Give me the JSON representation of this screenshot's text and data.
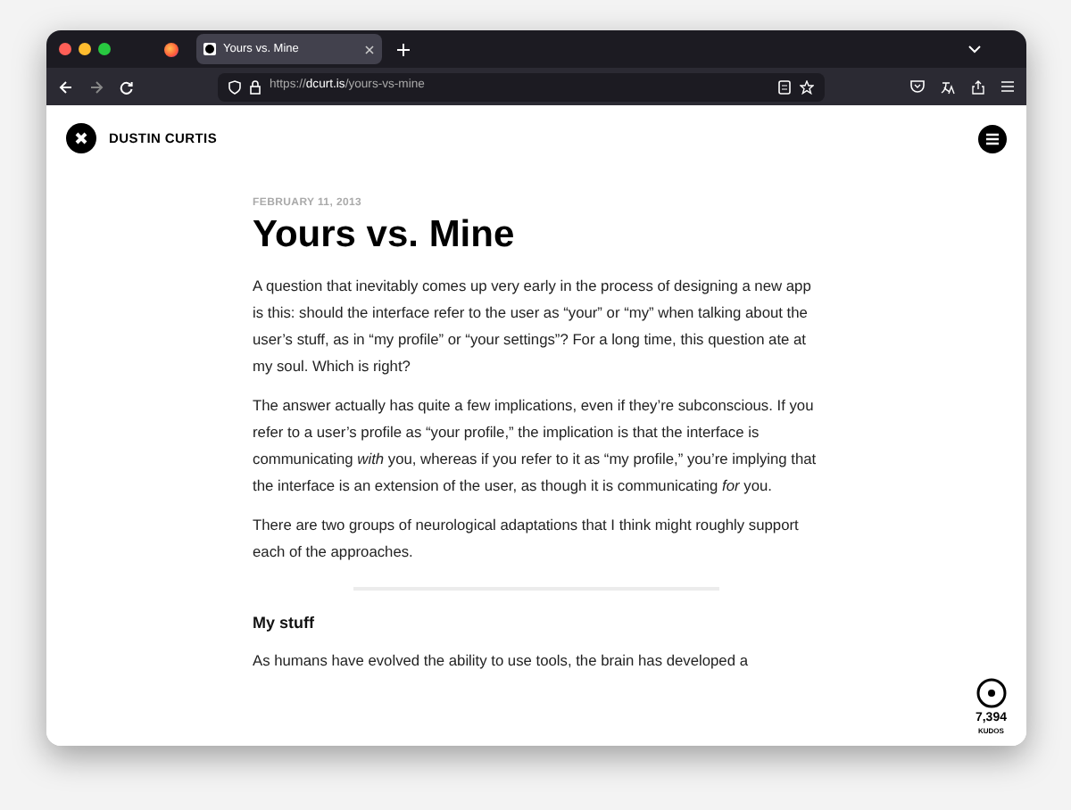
{
  "browser": {
    "tab": {
      "title": "Yours vs. Mine",
      "selected": true
    },
    "url": {
      "scheme": "https://",
      "domain": "dcurt.is",
      "path": "/yours-vs-mine"
    }
  },
  "site": {
    "name": "DUSTIN CURTIS"
  },
  "article": {
    "date": "FEBRUARY 11, 2013",
    "title": "Yours vs. Mine",
    "blocks": [
      {
        "kind": "paragraph",
        "text": "A question that inevitably comes up very early in the process of designing a new app is this: should the interface refer to the user as “your” or “my” when talking about the user’s stuff, as in “my profile” or “your settings”? For a long time, this question ate at my soul. Which is right?"
      },
      {
        "kind": "paragraph",
        "text": "The answer actually has quite a few implications, even if they’re subconscious. If you refer to a user’s profile as “your profile,” the implication is that the interface is communicating *with* you, whereas if you refer to it as “my profile,” you’re implying that the interface is an extension of the user, as though it is communicating *for* you."
      },
      {
        "kind": "paragraph",
        "text": "There are two groups of neurological adaptations that I think might roughly support each of the approaches."
      },
      {
        "kind": "rule"
      },
      {
        "kind": "heading",
        "text": "My stuff"
      },
      {
        "kind": "paragraph",
        "text": "As humans have evolved the ability to use tools, the brain has developed a"
      }
    ]
  },
  "kudos": {
    "count": "7,394",
    "label": "KUDOS"
  }
}
